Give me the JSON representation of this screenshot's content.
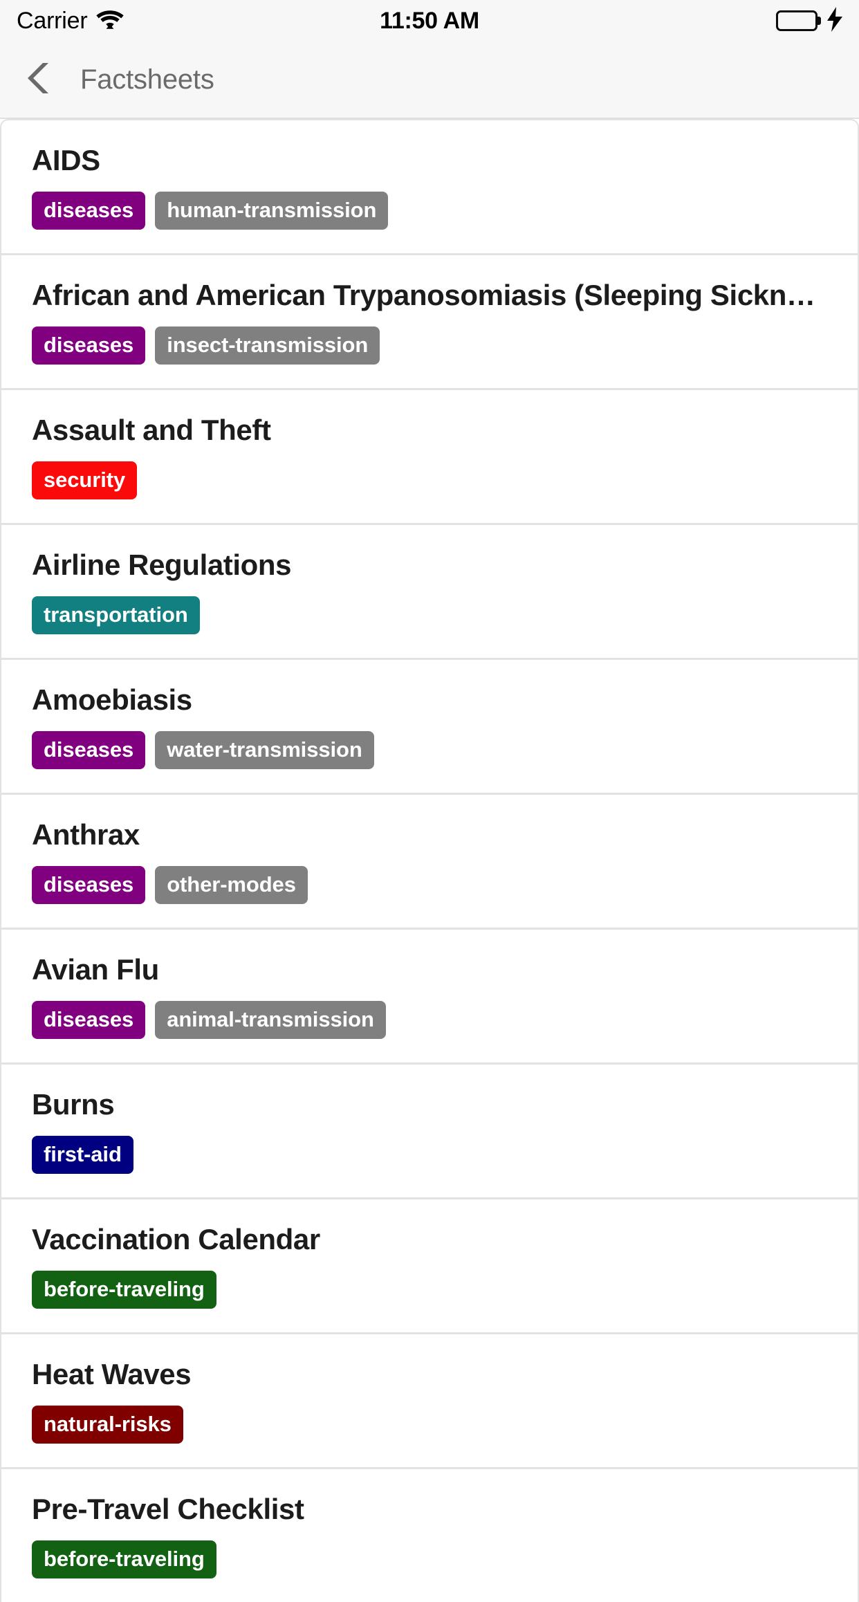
{
  "status_bar": {
    "carrier": "Carrier",
    "wifi_icon": "wifi-icon",
    "time": "11:50 AM",
    "battery_icon": "battery-icon",
    "charging_icon": "lightning-bolt-icon",
    "battery_color": "#2ee635"
  },
  "nav_bar": {
    "back_icon": "chevron-left-icon",
    "title": "Factsheets"
  },
  "tag_colors": {
    "diseases": "#800080",
    "human-transmission": "#808080",
    "insect-transmission": "#808080",
    "water-transmission": "#808080",
    "other-modes": "#808080",
    "animal-transmission": "#808080",
    "security": "#fa0a0a",
    "transportation": "#128080",
    "first-aid": "#000080",
    "before-traveling": "#136113",
    "natural-risks": "#800000"
  },
  "list": {
    "items": [
      {
        "title": "AIDS",
        "tags": [
          {
            "label": "diseases",
            "color": "#800080"
          },
          {
            "label": "human-transmission",
            "color": "#808080"
          }
        ]
      },
      {
        "title": "African and American Trypanosomiasis (Sleeping Sickn…",
        "tags": [
          {
            "label": "diseases",
            "color": "#800080"
          },
          {
            "label": "insect-transmission",
            "color": "#808080"
          }
        ]
      },
      {
        "title": "Assault and Theft",
        "tags": [
          {
            "label": "security",
            "color": "#fa0a0a"
          }
        ]
      },
      {
        "title": "Airline Regulations",
        "tags": [
          {
            "label": "transportation",
            "color": "#128080"
          }
        ]
      },
      {
        "title": "Amoebiasis",
        "tags": [
          {
            "label": "diseases",
            "color": "#800080"
          },
          {
            "label": "water-transmission",
            "color": "#808080"
          }
        ]
      },
      {
        "title": "Anthrax",
        "tags": [
          {
            "label": "diseases",
            "color": "#800080"
          },
          {
            "label": "other-modes",
            "color": "#808080"
          }
        ]
      },
      {
        "title": "Avian Flu",
        "tags": [
          {
            "label": "diseases",
            "color": "#800080"
          },
          {
            "label": "animal-transmission",
            "color": "#808080"
          }
        ]
      },
      {
        "title": "Burns",
        "tags": [
          {
            "label": "first-aid",
            "color": "#000080"
          }
        ]
      },
      {
        "title": "Vaccination Calendar",
        "tags": [
          {
            "label": "before-traveling",
            "color": "#136113"
          }
        ]
      },
      {
        "title": "Heat Waves",
        "tags": [
          {
            "label": "natural-risks",
            "color": "#800000"
          }
        ]
      },
      {
        "title": "Pre-Travel Checklist",
        "tags": [
          {
            "label": "before-traveling",
            "color": "#136113"
          }
        ]
      }
    ]
  }
}
